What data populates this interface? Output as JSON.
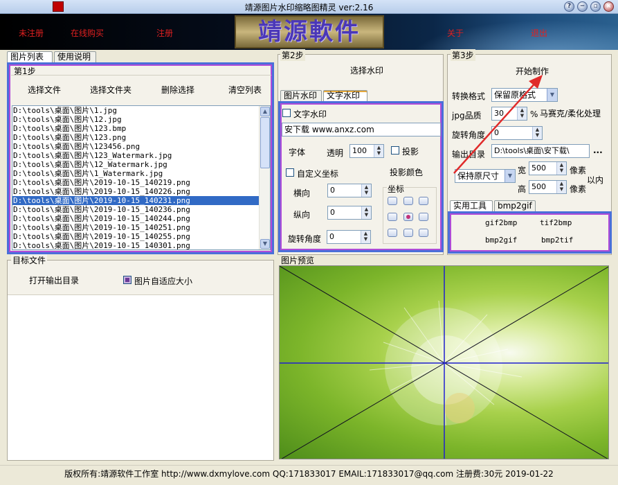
{
  "window": {
    "title": "靖源图片水印缩略图精灵 ver:2.16"
  },
  "banner": {
    "unregistered": "未注册",
    "buy_online": "在线购买",
    "register": "注册",
    "logo_text": "靖源軟件",
    "about": "关于",
    "exit": "退出"
  },
  "left": {
    "tabs": [
      "图片列表",
      "使用说明"
    ],
    "step_title": "第1步",
    "buttons": {
      "select_files": "选择文件",
      "select_folder": "选择文件夹",
      "delete_selection": "删除选择",
      "clear_list": "清空列表"
    },
    "files": [
      "D:\\tools\\桌面\\图片\\1.jpg",
      "D:\\tools\\桌面\\图片\\12.jpg",
      "D:\\tools\\桌面\\图片\\123.bmp",
      "D:\\tools\\桌面\\图片\\123.png",
      "D:\\tools\\桌面\\图片\\123456.png",
      "D:\\tools\\桌面\\图片\\123_Watermark.jpg",
      "D:\\tools\\桌面\\图片\\12_Watermark.jpg",
      "D:\\tools\\桌面\\图片\\1_Watermark.jpg",
      "D:\\tools\\桌面\\图片\\2019-10-15_140219.png",
      "D:\\tools\\桌面\\图片\\2019-10-15_140226.png",
      "D:\\tools\\桌面\\图片\\2019-10-15_140231.png",
      "D:\\tools\\桌面\\图片\\2019-10-15_140236.png",
      "D:\\tools\\桌面\\图片\\2019-10-15_140244.png",
      "D:\\tools\\桌面\\图片\\2019-10-15_140251.png",
      "D:\\tools\\桌面\\图片\\2019-10-15_140255.png",
      "D:\\tools\\桌面\\图片\\2019-10-15_140301.png"
    ],
    "selected_index": 10,
    "target_title": "目标文件",
    "open_output_dir": "打开输出目录",
    "auto_fit": "图片自适应大小"
  },
  "middle": {
    "step_title": "第2步",
    "select_watermark": "选择水印",
    "tabs": [
      "图片水印",
      "文字水印"
    ],
    "text_watermark_label": "文字水印",
    "text_value": "安下载  www.anxz.com",
    "font_label": "字体",
    "opacity_label": "透明",
    "opacity_value": "100",
    "shadow_label": "投影",
    "custom_coord_label": "自定义坐标",
    "shadow_color_label": "投影颜色",
    "x_label": "横向",
    "x_value": "0",
    "y_label": "纵向",
    "y_value": "0",
    "coord_label": "坐标",
    "rotate_label": "旋转角度",
    "rotate_value": "0",
    "preview_title": "图片预览"
  },
  "right": {
    "step_title": "第3步",
    "start": "开始制作",
    "format_label": "转换格式",
    "format_value": "保留原格式",
    "jpg_quality_label": "jpg品质",
    "jpg_quality_value": "30",
    "percent": "%",
    "mosaic_label": "马赛克/柔化处理",
    "rotate_label": "旋转角度",
    "rotate_value": "0",
    "output_label": "输出目录",
    "output_value": "D:\\tools\\桌面\\安下载\\",
    "browse": "...",
    "size_mode": "保持原尺寸",
    "width_label": "宽",
    "width_value": "500",
    "height_label": "高",
    "height_value": "500",
    "pixel_unit": "像素",
    "within": "以内",
    "tool_tabs": [
      "实用工具",
      "bmp2gif"
    ],
    "tools": [
      "gif2bmp",
      "tif2bmp",
      "bmp2gif",
      "bmp2tif"
    ]
  },
  "status": {
    "text": "版权所有:靖源软件工作室 http://www.dxmylove.com QQ:171833017 EMAIL:171833017@qq.com 注册费:30元 2019-01-22"
  },
  "colors": {
    "link_red": "#e02020",
    "selection_blue": "#316ac5",
    "frame_purple": "#b04bd8",
    "frame_blue": "#4a6fd9",
    "annotation_red": "#e02a2a"
  }
}
